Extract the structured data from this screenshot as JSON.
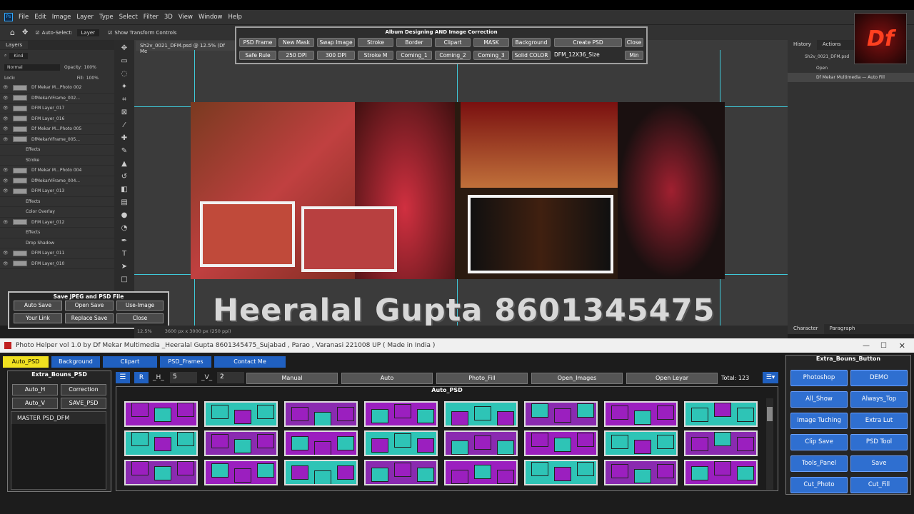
{
  "menu": {
    "items": [
      "File",
      "Edit",
      "Image",
      "Layer",
      "Type",
      "Select",
      "Filter",
      "3D",
      "View",
      "Window",
      "Help"
    ]
  },
  "options": {
    "auto_select": "Auto-Select:",
    "layer": "Layer",
    "show_transform": "Show Transform Controls"
  },
  "layers_panel": {
    "tab": "Layers",
    "kind": "Kind",
    "blend": "Normal",
    "opacity_label": "Opacity:",
    "opacity": "100%",
    "lock": "Lock:",
    "fill_label": "Fill:",
    "fill": "100%",
    "items": [
      {
        "name": "Df Mekar M...Photo 002",
        "sub": false
      },
      {
        "name": "DfMekarVFrame_002...",
        "sub": false
      },
      {
        "name": "DFM Layer_017",
        "sub": false
      },
      {
        "name": "DFM Layer_016",
        "sub": false
      },
      {
        "name": "Df Mekar M...Photo 005",
        "sub": false
      },
      {
        "name": "DfMekarVFrame_005...",
        "sub": false
      },
      {
        "name": "Effects",
        "sub": true
      },
      {
        "name": "Stroke",
        "sub": true
      },
      {
        "name": "Df Mekar M...Photo 004",
        "sub": false
      },
      {
        "name": "DfMekarVFrame_004...",
        "sub": false
      },
      {
        "name": "DFM Layer_013",
        "sub": false
      },
      {
        "name": "Effects",
        "sub": true
      },
      {
        "name": "Color Overlay",
        "sub": true
      },
      {
        "name": "DFM Layer_012",
        "sub": false
      },
      {
        "name": "Effects",
        "sub": true
      },
      {
        "name": "Drop Shadow",
        "sub": true
      },
      {
        "name": "DFM Layer_011",
        "sub": false
      },
      {
        "name": "DFM Layer_010",
        "sub": false
      }
    ]
  },
  "doc_tab": "Sh2v_0021_DFM.psd @ 12.5% (Df Me",
  "album": {
    "title": "Album Designing  AND  Image Correction",
    "row1": [
      "PSD Frame",
      "New Mask",
      "Swap Image",
      "Stroke",
      "Border",
      "Clipart",
      "MASK",
      "Background",
      "Create PSD",
      "Close"
    ],
    "row2": [
      "Safe Rule",
      "250 DPI",
      "300 DPI",
      "Stroke M",
      "Coming_1",
      "Coming_2",
      "Coming_3",
      "Solid COLOR",
      "DFM_12X36_Size",
      "Min"
    ]
  },
  "canvas": {
    "name_line": "Heeralal Gupta   8601345475"
  },
  "save_box": {
    "title": "Save JPEG and PSD File",
    "buttons": [
      "Auto Save",
      "Open Save",
      "Use-Image",
      "Your Link",
      "Replace Save",
      "Close"
    ]
  },
  "history": {
    "tabs": [
      "History",
      "Actions"
    ],
    "items": [
      "Sh2v_0021_DFM.psd",
      "Open",
      "Df Mekar Multimedia — Auto Fill"
    ]
  },
  "char": {
    "tabs": [
      "Character",
      "Paragraph"
    ]
  },
  "status": {
    "zoom": "12.5%",
    "size": "3600 px x 3000 px (250 ppi)"
  },
  "helper": {
    "title": "Photo Helper vol 1.0 by Df Mekar Multimedia _Heeralal Gupta 8601345475_Sujabad , Parao , Varanasi 221008 UP ( Made in India )",
    "tabs": [
      "Auto_PSD",
      "Background",
      "Clipart",
      "PSD_Frames",
      "Contact Me"
    ],
    "extra_psd": {
      "title": "Extra_Bouns_PSD",
      "buttons": [
        "Auto_H",
        "Correction",
        "Auto_V",
        "SAVE_PSD"
      ],
      "list": "MASTER PSD_DFM"
    },
    "controls": {
      "r": "R",
      "h_label": "_H_",
      "h_val": "5",
      "v_label": "_V_",
      "v_val": "2",
      "buttons": [
        "Manual",
        "Auto",
        "Photo_Fill",
        "Open_Images",
        "Open Leyar"
      ],
      "total": "Total: 123"
    },
    "grid_title": "Auto_PSD",
    "extra_btn": {
      "title": "Extra_Bouns_Button",
      "buttons": [
        "Photoshop",
        "DEMO",
        "All_Show",
        "Always_Top",
        "Image Tuching",
        "Extra Lut",
        "Clip Save",
        "PSD Tool",
        "Tools_Panel",
        "Save",
        "Cut_Photo",
        "Cut_Fill"
      ]
    }
  },
  "colors": {
    "accent_blue": "#2f6fd0",
    "tab_yellow": "#f0e020",
    "purple": "#9b1fbf",
    "teal": "#2ec4b6"
  }
}
